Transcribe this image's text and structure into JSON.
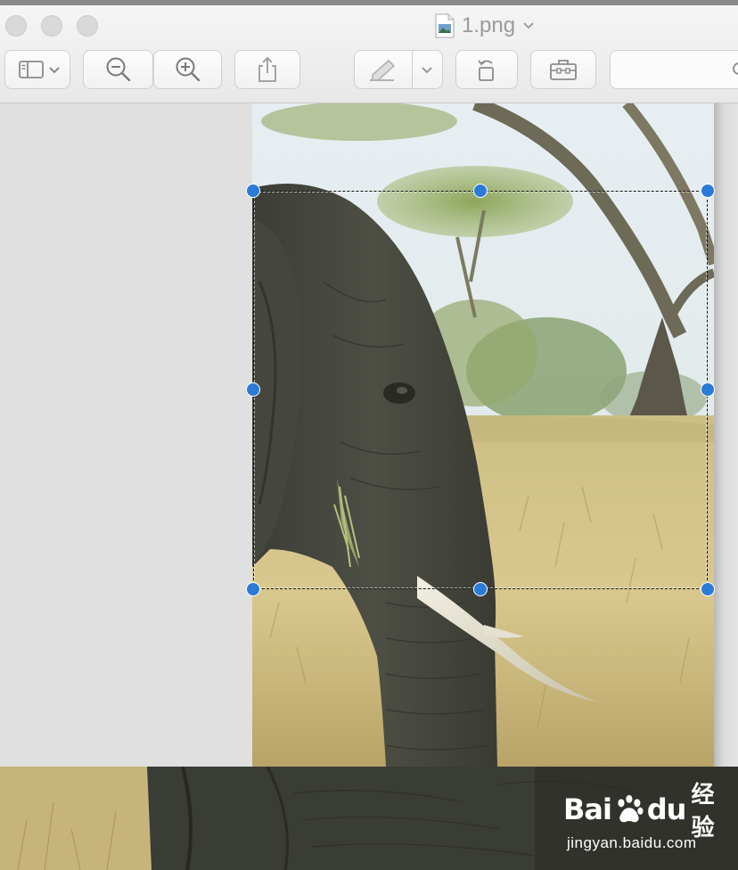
{
  "window": {
    "title": "1.png"
  },
  "toolbar": {
    "buttons": [
      {
        "name": "sidebar-toggle",
        "icon": "sidebar-icon"
      },
      {
        "name": "zoom-out",
        "icon": "zoom-out-icon"
      },
      {
        "name": "zoom-in",
        "icon": "zoom-in-icon"
      },
      {
        "name": "share",
        "icon": "share-icon"
      },
      {
        "name": "markup",
        "icon": "pen-icon"
      },
      {
        "name": "rotate-left",
        "icon": "rotate-left-icon"
      },
      {
        "name": "markup-toolbox",
        "icon": "toolbox-icon"
      }
    ],
    "search": {
      "value": "",
      "placeholder": ""
    }
  },
  "canvas": {
    "image_description_visible": "elephant photo",
    "selection_handles": 8
  },
  "watermark": {
    "brand_latin_1": "Bai",
    "brand_latin_2": "du",
    "brand_cn": "经验",
    "url": "jingyan.baidu.com"
  },
  "colors": {
    "selection_handle": "#2b7bd6",
    "chrome_bg": "#ececec",
    "canvas_bg": "#e0e0e0"
  }
}
